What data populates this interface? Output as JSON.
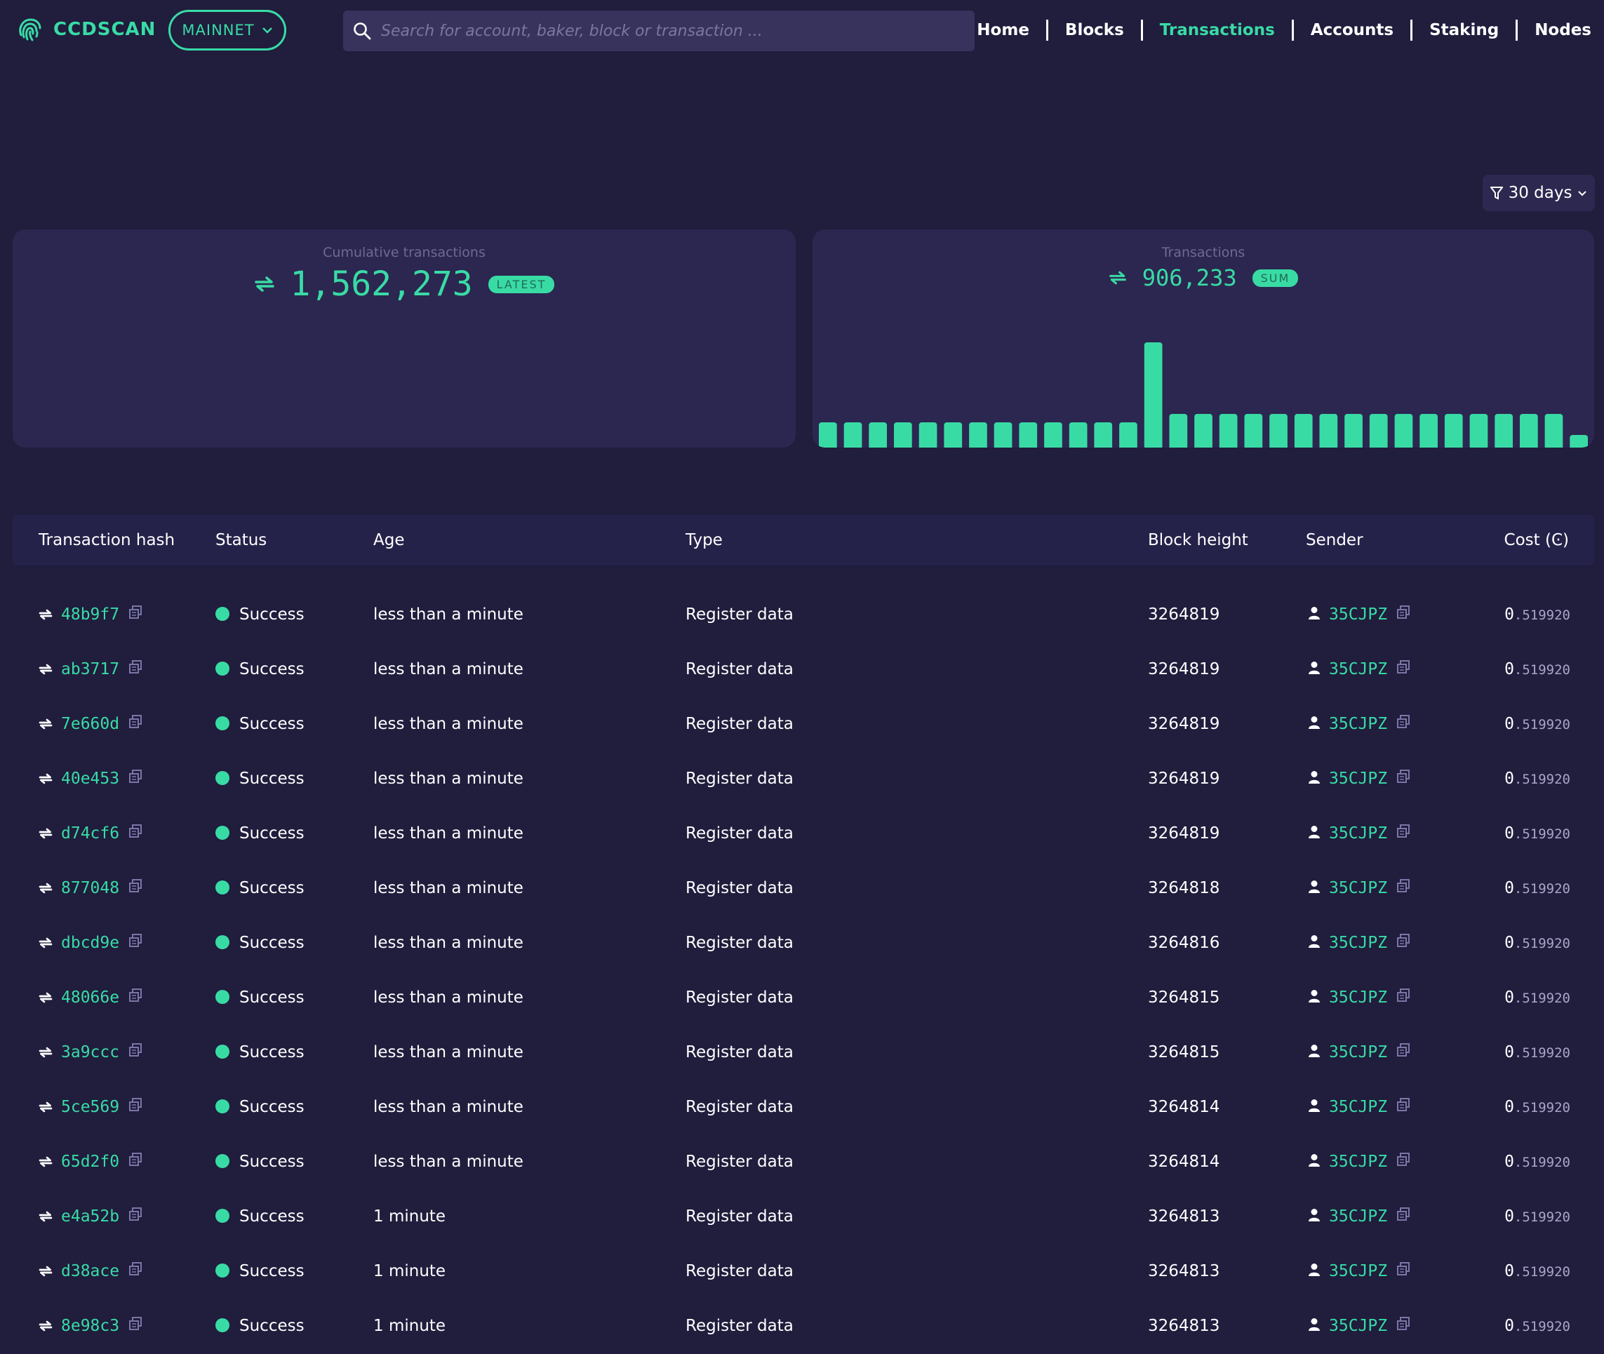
{
  "header": {
    "brand": "CCDSCAN",
    "network": "MAINNET",
    "search_placeholder": "Search for account, baker, block or transaction ...",
    "nav": [
      {
        "label": "Home",
        "active": false
      },
      {
        "label": "Blocks",
        "active": false
      },
      {
        "label": "Transactions",
        "active": true
      },
      {
        "label": "Accounts",
        "active": false
      },
      {
        "label": "Staking",
        "active": false
      },
      {
        "label": "Nodes",
        "active": false
      }
    ]
  },
  "filter": {
    "label": "30 days",
    "icon": "filter-icon"
  },
  "cumulative": {
    "title": "Cumulative transactions",
    "value": "1,562,273",
    "badge": "LATEST"
  },
  "transactions_card": {
    "title": "Transactions",
    "value": "906,233",
    "badge": "SUM"
  },
  "chart_data": {
    "type": "bar",
    "title": "Transactions",
    "series": [
      {
        "values": [
          6,
          6,
          6,
          6,
          6,
          6,
          6,
          6,
          6,
          6,
          6,
          6,
          6,
          25,
          8,
          8,
          8,
          8,
          8,
          8,
          8,
          8,
          8,
          8,
          8,
          8,
          8,
          8,
          8,
          8,
          3
        ]
      }
    ],
    "ylim": [
      0,
      30
    ],
    "grid": false,
    "color": "#39dba5"
  },
  "table": {
    "columns": [
      "Transaction hash",
      "Status",
      "Age",
      "Type",
      "Block height",
      "Sender",
      "Cost (Ͼ)"
    ],
    "rows": [
      {
        "hash": "48b9f7",
        "status": "Success",
        "age": "less than a minute",
        "type": "Register data",
        "block": "3264819",
        "sender": "35CJPZ",
        "cost_int": "0",
        "cost_dec": ".519920"
      },
      {
        "hash": "ab3717",
        "status": "Success",
        "age": "less than a minute",
        "type": "Register data",
        "block": "3264819",
        "sender": "35CJPZ",
        "cost_int": "0",
        "cost_dec": ".519920"
      },
      {
        "hash": "7e660d",
        "status": "Success",
        "age": "less than a minute",
        "type": "Register data",
        "block": "3264819",
        "sender": "35CJPZ",
        "cost_int": "0",
        "cost_dec": ".519920"
      },
      {
        "hash": "40e453",
        "status": "Success",
        "age": "less than a minute",
        "type": "Register data",
        "block": "3264819",
        "sender": "35CJPZ",
        "cost_int": "0",
        "cost_dec": ".519920"
      },
      {
        "hash": "d74cf6",
        "status": "Success",
        "age": "less than a minute",
        "type": "Register data",
        "block": "3264819",
        "sender": "35CJPZ",
        "cost_int": "0",
        "cost_dec": ".519920"
      },
      {
        "hash": "877048",
        "status": "Success",
        "age": "less than a minute",
        "type": "Register data",
        "block": "3264818",
        "sender": "35CJPZ",
        "cost_int": "0",
        "cost_dec": ".519920"
      },
      {
        "hash": "dbcd9e",
        "status": "Success",
        "age": "less than a minute",
        "type": "Register data",
        "block": "3264816",
        "sender": "35CJPZ",
        "cost_int": "0",
        "cost_dec": ".519920"
      },
      {
        "hash": "48066e",
        "status": "Success",
        "age": "less than a minute",
        "type": "Register data",
        "block": "3264815",
        "sender": "35CJPZ",
        "cost_int": "0",
        "cost_dec": ".519920"
      },
      {
        "hash": "3a9ccc",
        "status": "Success",
        "age": "less than a minute",
        "type": "Register data",
        "block": "3264815",
        "sender": "35CJPZ",
        "cost_int": "0",
        "cost_dec": ".519920"
      },
      {
        "hash": "5ce569",
        "status": "Success",
        "age": "less than a minute",
        "type": "Register data",
        "block": "3264814",
        "sender": "35CJPZ",
        "cost_int": "0",
        "cost_dec": ".519920"
      },
      {
        "hash": "65d2f0",
        "status": "Success",
        "age": "less than a minute",
        "type": "Register data",
        "block": "3264814",
        "sender": "35CJPZ",
        "cost_int": "0",
        "cost_dec": ".519920"
      },
      {
        "hash": "e4a52b",
        "status": "Success",
        "age": "1 minute",
        "type": "Register data",
        "block": "3264813",
        "sender": "35CJPZ",
        "cost_int": "0",
        "cost_dec": ".519920"
      },
      {
        "hash": "d38ace",
        "status": "Success",
        "age": "1 minute",
        "type": "Register data",
        "block": "3264813",
        "sender": "35CJPZ",
        "cost_int": "0",
        "cost_dec": ".519920"
      },
      {
        "hash": "8e98c3",
        "status": "Success",
        "age": "1 minute",
        "type": "Register data",
        "block": "3264813",
        "sender": "35CJPZ",
        "cost_int": "0",
        "cost_dec": ".519920"
      }
    ]
  },
  "colors": {
    "background": "#201d3d",
    "accent": "#39dba5",
    "card": "#2b2750",
    "muted": "#6d6a96"
  }
}
